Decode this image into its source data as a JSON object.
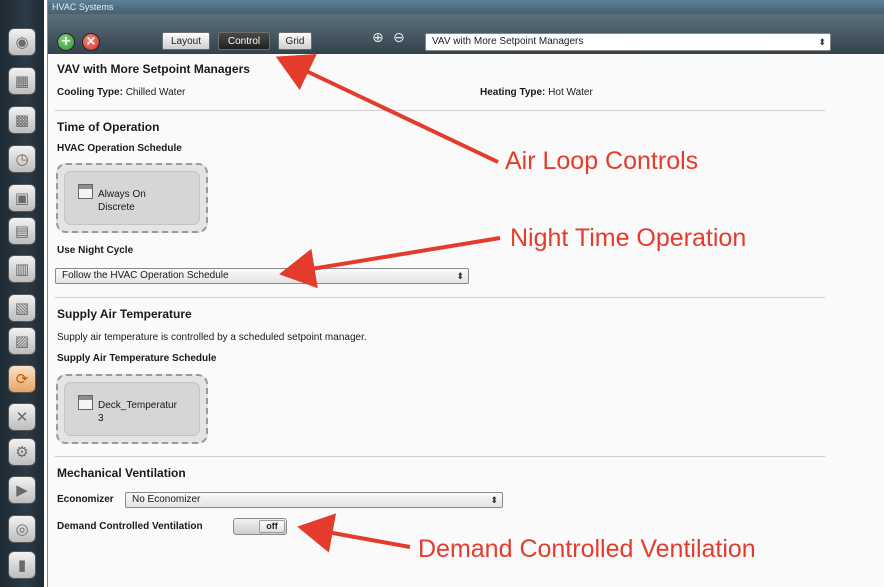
{
  "window": {
    "title": "HVAC Systems"
  },
  "toolbar": {
    "add_icon": "plus-icon",
    "remove_icon": "close-icon",
    "tabs": [
      {
        "label": "Layout",
        "active": false
      },
      {
        "label": "Control",
        "active": true
      },
      {
        "label": "Grid",
        "active": false
      }
    ],
    "zoom_in_icon": "zoom-in-icon",
    "zoom_out_icon": "zoom-out-icon",
    "system_select_value": "VAV with More Setpoint Managers"
  },
  "sidebar": {
    "icons": [
      "location-icon",
      "building-icon",
      "materials-icon",
      "schedule-icon",
      "loads-icon",
      "space-types-icon",
      "geometry-icon",
      "facility-icon",
      "spaces-icon",
      "hvac-systems-icon",
      "tools-icon",
      "measures-icon",
      "run-icon",
      "output-icon",
      "results-icon"
    ],
    "active_index": 9
  },
  "system": {
    "name": "VAV with More Setpoint Managers",
    "cooling_label": "Cooling Type:",
    "cooling_value": "Chilled Water",
    "heating_label": "Heating Type:",
    "heating_value": "Hot Water"
  },
  "time_of_operation": {
    "heading": "Time of Operation",
    "schedule_label": "HVAC Operation Schedule",
    "schedule_line1": "Always On",
    "schedule_line2": "Discrete",
    "night_cycle_label": "Use Night Cycle",
    "night_cycle_value": "Follow the HVAC Operation Schedule"
  },
  "supply_air": {
    "heading": "Supply Air Temperature",
    "description": "Supply air temperature is controlled by a scheduled setpoint manager.",
    "schedule_label": "Supply Air Temperature Schedule",
    "schedule_line1": "Deck_Temperatur",
    "schedule_line2": "3"
  },
  "mechanical_ventilation": {
    "heading": "Mechanical Ventilation",
    "economizer_label": "Economizer",
    "economizer_value": "No Economizer",
    "dcv_label": "Demand Controlled Ventilation",
    "dcv_state": "off"
  },
  "annotations": {
    "air_loop": "Air Loop Controls",
    "night_time": "Night Time Operation",
    "dcv": "Demand Controlled Ventilation",
    "color": "#e43c2c"
  },
  "colors": {
    "toolbar": "#3f505b",
    "sidebar": "#25323c",
    "active_tab": "#2a2a2a",
    "add_button": "#3aa23a",
    "remove_button": "#d9362b",
    "active_sidebar": "#e6a463"
  }
}
